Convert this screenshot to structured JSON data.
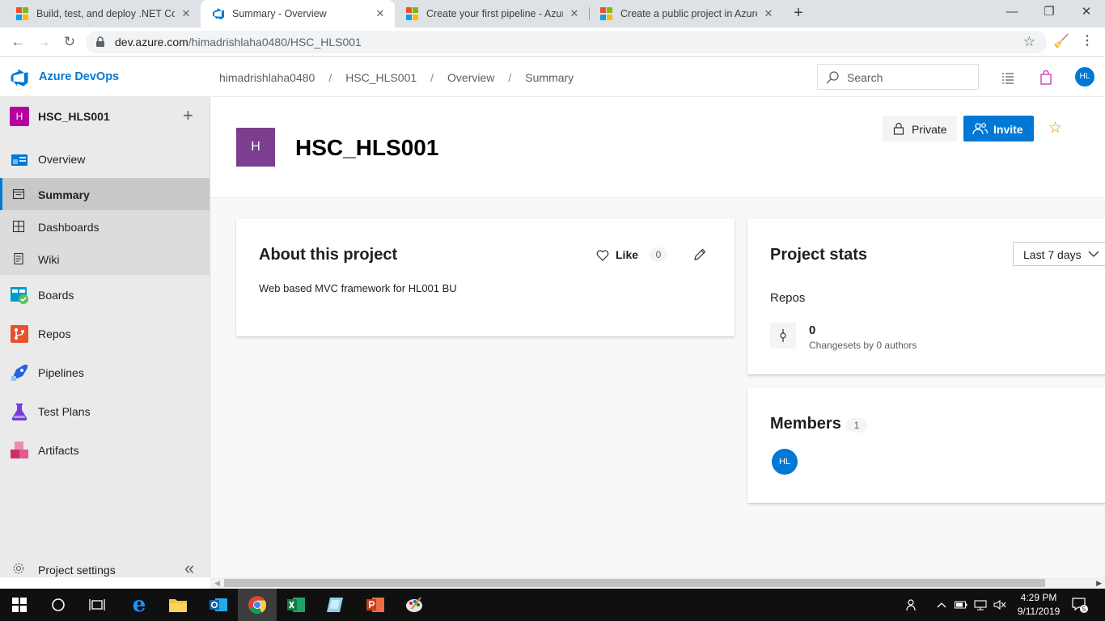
{
  "browser": {
    "tabs": [
      {
        "title": "Build, test, and deploy .NET Core",
        "active": false
      },
      {
        "title": "Summary - Overview",
        "active": true
      },
      {
        "title": "Create your first pipeline - Azure",
        "active": false
      },
      {
        "title": "Create a public project in Azure D",
        "active": false
      }
    ],
    "url_host": "dev.azure.com",
    "url_path": "/himadrishlaha0480/HSC_HLS001"
  },
  "header": {
    "brand": "Azure DevOps",
    "breadcrumb": [
      "himadrishlaha0480",
      "HSC_HLS001",
      "Overview",
      "Summary"
    ],
    "search_placeholder": "Search",
    "user_initials": "HL"
  },
  "sidebar": {
    "project_initial": "H",
    "project_name": "HSC_HLS001",
    "items": [
      {
        "label": "Overview",
        "icon": "overview-icon"
      },
      {
        "label": "Summary",
        "icon": "summary-icon",
        "selected": true
      },
      {
        "label": "Dashboards",
        "icon": "dashboards-icon"
      },
      {
        "label": "Wiki",
        "icon": "wiki-icon"
      },
      {
        "label": "Boards",
        "icon": "boards-icon"
      },
      {
        "label": "Repos",
        "icon": "repos-icon"
      },
      {
        "label": "Pipelines",
        "icon": "pipelines-icon"
      },
      {
        "label": "Test Plans",
        "icon": "test-plans-icon"
      },
      {
        "label": "Artifacts",
        "icon": "artifacts-icon"
      }
    ],
    "settings_label": "Project settings"
  },
  "project": {
    "initial": "H",
    "title": "HSC_HLS001",
    "private_label": "Private",
    "invite_label": "Invite"
  },
  "about": {
    "title": "About this project",
    "like_label": "Like",
    "like_count": "0",
    "description": "Web based MVC framework for HL001 BU"
  },
  "stats": {
    "title": "Project stats",
    "range": "Last 7 days",
    "repos_label": "Repos",
    "changesets_value": "0",
    "changesets_caption": "Changesets by 0 authors"
  },
  "members": {
    "title": "Members",
    "count": "1",
    "initials": "HL"
  },
  "taskbar": {
    "time": "4:29 PM",
    "date": "9/11/2019",
    "notifications": "5"
  },
  "colors": {
    "accent": "#0078d4",
    "project_badge": "#b4009e",
    "project_tile": "#7c3f90"
  }
}
